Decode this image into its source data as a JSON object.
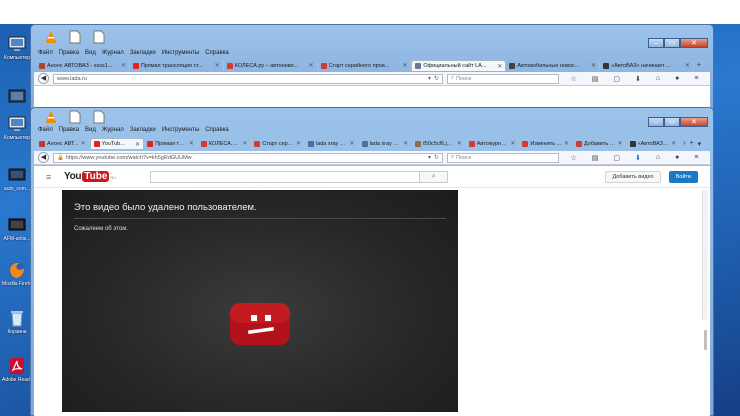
{
  "desktop": {
    "icons": [
      {
        "name": "computer-icon",
        "label": "Компьютер"
      },
      {
        "name": "computer-icon-2",
        "label": "Компьютер"
      },
      {
        "name": "auto-com-icon",
        "label": "auto_com..."
      },
      {
        "name": "afm-icon",
        "label": "AFM-antis..."
      },
      {
        "name": "firefox-icon",
        "label": "Mozilla Firefox"
      },
      {
        "name": "recycle-bin-icon",
        "label": "Корзина"
      },
      {
        "name": "adobe-reader-icon",
        "label": "Adobe Reader X"
      }
    ]
  },
  "menu": {
    "file": "Файл",
    "edit": "Правка",
    "view": "Вид",
    "history": "Журнал",
    "bookmarks": "Закладки",
    "tools": "Инструменты",
    "help": "Справка"
  },
  "back_window": {
    "tabs": [
      {
        "label": "Анонс АВТОВАЗ - ssss1...",
        "color": "#c0392b"
      },
      {
        "label": "Прямая трансляция ст...",
        "color": "#e62117"
      },
      {
        "label": "КОЛЕСА.ру – автоново...",
        "color": "#d63a2f"
      },
      {
        "label": "Старт серийного прои...",
        "color": "#d63a2f"
      },
      {
        "label": "Официальный сайт LA...",
        "color": "#6b7a8f"
      },
      {
        "label": "Автомобильные новос...",
        "color": "#444444"
      },
      {
        "label": "«АвтоВАЗ» начинает ...",
        "color": "#333333"
      }
    ],
    "url": "www.lada.ru",
    "search_placeholder": "Поиск"
  },
  "front_window": {
    "tabs": [
      {
        "label": "Анонс АВТ...",
        "color": "#c0392b"
      },
      {
        "label": "YouTub...",
        "color": "#e62117"
      },
      {
        "label": "Прямая тра...",
        "color": "#e62117"
      },
      {
        "label": "КОЛЕСА.ру...",
        "color": "#d63a2f"
      },
      {
        "label": "Старт сери...",
        "color": "#d63a2f"
      },
      {
        "label": "lada xray на...",
        "color": "#4a6fa5"
      },
      {
        "label": "lada xray на...",
        "color": "#4a6fa5"
      },
      {
        "label": "f50c5cf6.jpg...",
        "color": "#8d6e4a"
      },
      {
        "label": "Автожурна...",
        "color": "#d63a2f"
      },
      {
        "label": "Изменить ...",
        "color": "#d63a2f"
      },
      {
        "label": "Добавить С...",
        "color": "#d63a2f"
      },
      {
        "label": "«АвтоВАЗ»...",
        "color": "#333333"
      }
    ],
    "url": "https://www.youtube.com/watch?v=kh5gRdGUUMw",
    "search_placeholder": "Поиск"
  },
  "youtube": {
    "logo_you": "You",
    "logo_tube": "Tube",
    "logo_region": "RU",
    "upload_label": "Добавить видео",
    "login_label": "Войти",
    "error_title": "Это видео было удалено пользователем.",
    "error_subtitle": "Сожалеем об этом.",
    "accent": "#cc181e"
  }
}
